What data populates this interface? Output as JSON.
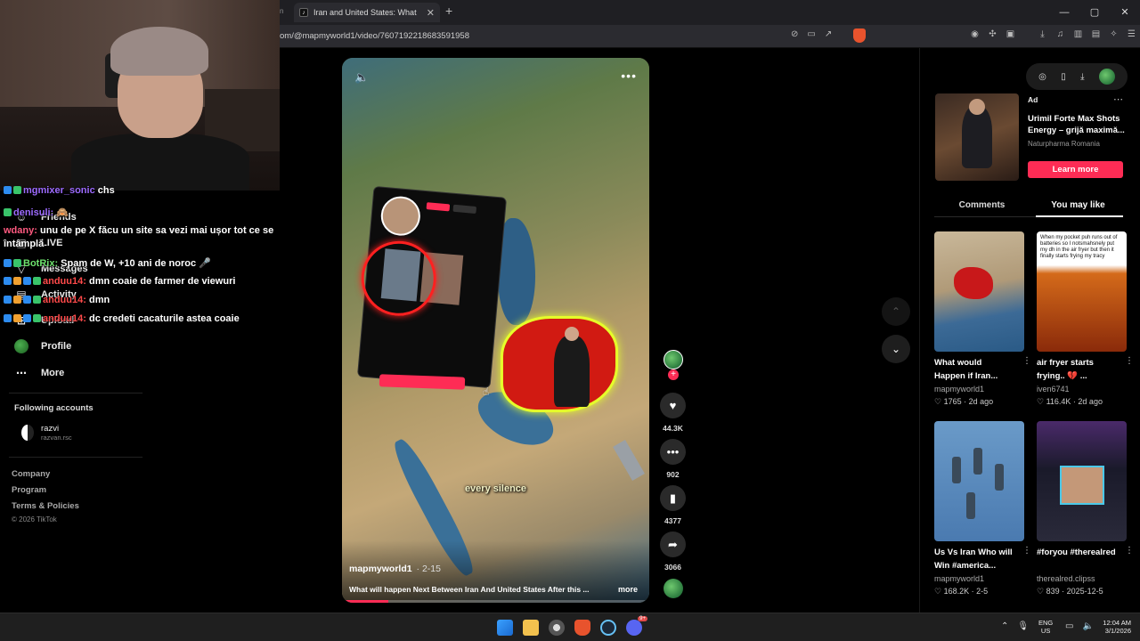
{
  "browser": {
    "tab_stub": "n",
    "tab_title": "Iran and United States: What",
    "tab_favicon": "tiktok-icon",
    "url": "om/@mapmyworld1/video/7607192218683591958",
    "new_tab": "+",
    "window_controls": [
      "—",
      "▢",
      "✕"
    ]
  },
  "chat": {
    "messages": [
      {
        "name": "mgmixer_sonic",
        "text": "chs"
      },
      {
        "name": "denisuli:",
        "text": "🙈"
      },
      {
        "name": "wdany:",
        "text": "unu de pe X făcu un site sa vezi mai ușor tot ce se"
      },
      {
        "name": "",
        "text": "întâmplă"
      },
      {
        "name": "BotRix:",
        "text": "Spam de W, +10 ani de noroc 🎤"
      },
      {
        "name": "anduu14:",
        "text": "dmn coaie de farmer de viewuri"
      },
      {
        "name": "anduu14:",
        "text": "dmn"
      },
      {
        "name": "anduu14:",
        "text": "dc credeti cacaturile astea coaie"
      }
    ]
  },
  "nav": {
    "items": [
      {
        "label": "Friends",
        "icon": "friends-icon"
      },
      {
        "label": "LIVE",
        "icon": "live-icon"
      },
      {
        "label": "Messages",
        "icon": "messages-icon"
      },
      {
        "label": "Activity",
        "icon": "activity-icon"
      },
      {
        "label": "Upload",
        "icon": "upload-icon"
      },
      {
        "label": "Profile",
        "icon": "profile-avatar"
      },
      {
        "label": "More",
        "icon": "more-icon"
      }
    ],
    "following_title": "Following accounts",
    "following": [
      {
        "name": "razvi",
        "handle": "razvan.rsc"
      }
    ],
    "footer_links": [
      "Company",
      "Program",
      "Terms & Policies"
    ],
    "copyright": "© 2026 TikTok"
  },
  "video": {
    "author": "mapmyworld1",
    "date": "· 2-15",
    "description": "What will happen Next Between Iran And United States After this ...",
    "more": "more",
    "subtitle": "every silence",
    "progress": 0.15,
    "likes": "44.3K",
    "comments": "902",
    "saves": "4377",
    "shares": "3066"
  },
  "sidebar_right": {
    "ad": {
      "label": "Ad",
      "title": "Urimil Forte Max Shots Energy – grijă maximă...",
      "sponsor": "Naturpharma Romania",
      "cta": "Learn more"
    },
    "tabs": [
      "Comments",
      "You may like"
    ],
    "active_tab": "You may like",
    "recommendations": [
      {
        "title": "What would Happen if Iran...",
        "author": "mapmyworld1",
        "stats": "♡ 1765 · 2d ago"
      },
      {
        "title": "air fryer starts frying.. 💔 ...",
        "author": "iven6741",
        "stats": "♡ 116.4K · 2d ago"
      },
      {
        "title": "Us Vs Iran Who will Win #america...",
        "author": "mapmyworld1",
        "stats": "♡ 168.2K · 2-5"
      },
      {
        "title": "#foryou #therealred",
        "author": "therealred.clipss",
        "stats": "♡ 839 · 2025-12-5"
      }
    ],
    "rec2_caption": "When my pocket puh runs out of batteries so I notsmahsnely put my dh in the air fryer but then it finally starts frying my tracy"
  },
  "taskbar": {
    "lang_top": "ENG",
    "lang_bottom": "US",
    "time": "12:04 AM",
    "date": "3/1/2026",
    "discord_badge": "9+"
  }
}
